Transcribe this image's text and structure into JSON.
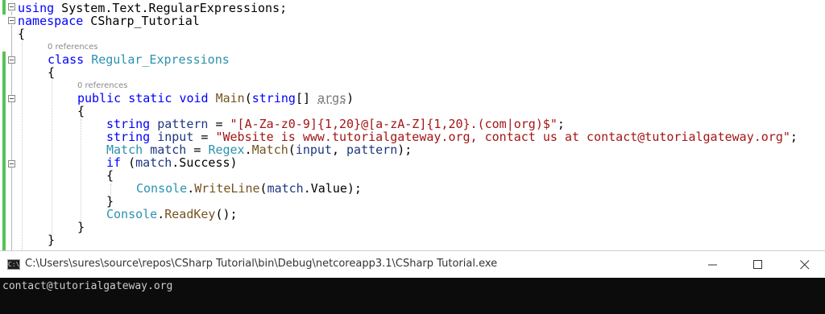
{
  "editor": {
    "lines": {
      "l0": {
        "k1": "using",
        "t1": " System.Text.RegularExpressions;"
      },
      "l1": {
        "k1": "namespace",
        "t1": " CSharp_Tutorial"
      },
      "l2": {
        "t1": "{"
      },
      "l3": {
        "k1": "class",
        "c1": "Regular_Expressions"
      },
      "l4": {
        "t1": "{"
      },
      "l5": {
        "k1": "public",
        "k2": "static",
        "k3": "void",
        "m1": "Main",
        "t1": "(",
        "k4": "string",
        "t2": "[] ",
        "p1": "args",
        "t3": ")"
      },
      "l6": {
        "t1": "{"
      },
      "l7": {
        "k1": "string",
        "p1": "pattern",
        "t1": " = ",
        "s1": "\"[A-Za-z0-9]{1,20}@[a-zA-Z]{1,20}.(com|org)$\"",
        "t2": ";"
      },
      "l8": {
        "k1": "string",
        "p1": "input",
        "t1": " = ",
        "s1": "\"Website is www.tutorialgateway.org, contact us at contact@tutorialgateway.org\"",
        "t2": ";"
      },
      "l9": {
        "c1": "Match",
        "p1": "match",
        "t1": " = ",
        "c2": "Regex",
        "t2": ".",
        "m1": "Match",
        "t3": "(",
        "p2": "input",
        "t4": ", ",
        "p3": "pattern",
        "t5": ");"
      },
      "l10": {
        "k1": "if",
        "t1": " (",
        "p1": "match",
        "t2": ".Success)"
      },
      "l11": {
        "t1": "{"
      },
      "l12": {
        "c1": "Console",
        "t1": ".",
        "m1": "WriteLine",
        "t2": "(",
        "p1": "match",
        "t3": ".Value);"
      },
      "l13": {
        "t1": "}"
      },
      "l14": {
        "c1": "Console",
        "t1": ".",
        "m1": "ReadKey",
        "t2": "();"
      },
      "l15": {
        "t1": "}"
      },
      "l16": {
        "t1": "}"
      }
    },
    "refs": {
      "class_refs": "0 references",
      "main_refs": "0 references"
    }
  },
  "console": {
    "title": "C:\\Users\\sures\\source\\repos\\CSharp Tutorial\\bin\\Debug\\netcoreapp3.1\\CSharp Tutorial.exe",
    "icon_label": "C:\\",
    "output": "contact@tutorialgateway.org",
    "buttons": [
      "minimize-icon",
      "maximize-icon",
      "close-icon"
    ]
  },
  "colors": {
    "keyword": "#0000ff",
    "type": "#2b91af",
    "string": "#a31515",
    "method": "#74531f",
    "parameter": "#1f377f",
    "console_bg": "#0c0c0c",
    "change_bar": "#57c257"
  }
}
